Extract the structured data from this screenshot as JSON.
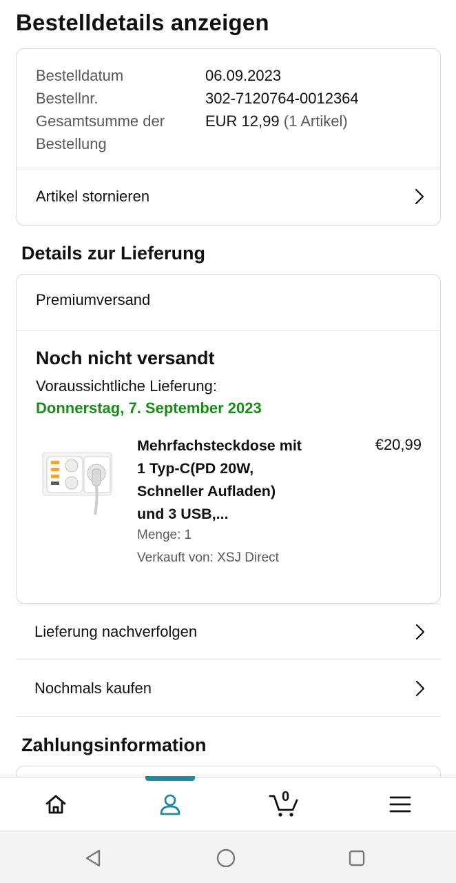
{
  "header": {
    "title": "Bestelldetails anzeigen"
  },
  "summary": {
    "order_date_label": "Bestelldatum",
    "order_date_value": "06.09.2023",
    "order_number_label": "Bestellnr.",
    "order_number_value": "302-7120764-0012364",
    "total_label_line1": "Gesamtsumme der",
    "total_label_line2": "Bestellung",
    "total_value": "EUR 12,99",
    "total_items": "(1 Artikel)",
    "cancel_label": "Artikel stornieren"
  },
  "delivery": {
    "section_title": "Details zur Lieferung",
    "shipping_type": "Premiumversand",
    "status": "Noch nicht versandt",
    "eta_label": "Voraussichtliche Lieferung:",
    "eta_date": "Donnerstag, 7. September 2023",
    "product": {
      "title_line1": "Mehrfachsteckdose mit",
      "title_line2": "1 Typ-C(PD 20W,",
      "title_line3": "Schneller Aufladen)",
      "title_line4": "und 3 USB,...",
      "price": "€20,99",
      "quantity": "Menge: 1",
      "seller": "Verkauft von: XSJ Direct"
    },
    "track_label": "Lieferung nachverfolgen",
    "buy_again_label": "Nochmals kaufen"
  },
  "payment": {
    "section_title": "Zahlungsinformation"
  },
  "bottom_nav": {
    "items": [
      "home-icon",
      "profile-icon",
      "cart-icon",
      "menu-icon"
    ],
    "cart_count": "0",
    "active": "profile-icon",
    "accent_color": "#1f8a99"
  },
  "system_nav": {
    "items": [
      "back-icon",
      "home-circle-icon",
      "recents-icon"
    ]
  },
  "colors": {
    "eta_green": "#1a8a1a",
    "muted_text": "#565959",
    "border": "#d5d9d9"
  }
}
